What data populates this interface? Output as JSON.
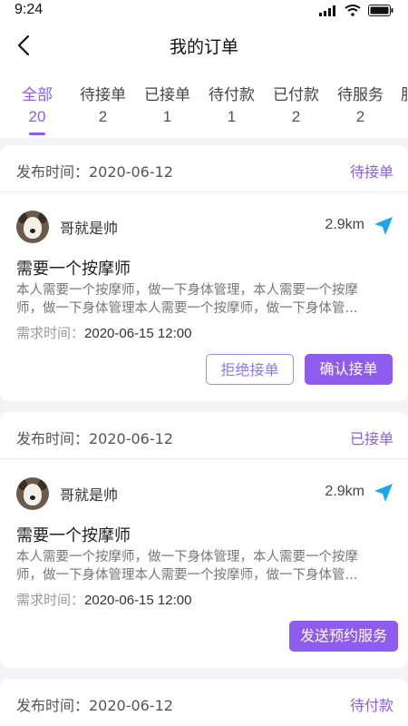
{
  "status_bar": {
    "time": "9:24"
  },
  "nav": {
    "title": "我的订单"
  },
  "tabs": [
    {
      "label": "全部",
      "count": "20"
    },
    {
      "label": "待接单",
      "count": "2"
    },
    {
      "label": "已接单",
      "count": "1"
    },
    {
      "label": "待付款",
      "count": "1"
    },
    {
      "label": "已付款",
      "count": "2"
    },
    {
      "label": "待服务",
      "count": "2"
    },
    {
      "label": "服",
      "count": ""
    }
  ],
  "orders": [
    {
      "publish_label": "发布时间：2020-06-12",
      "status": "待接单",
      "user_name": "哥就是帅",
      "distance": "2.9km",
      "title": "需要一个按摩师",
      "desc_line1": "本人需要一个按摩师，做一下身体管理，本人需要一个按摩",
      "desc_line2": "师，做一下身体管理本人需要一个按摩师，做一下身体管...",
      "demand_key": "需求时间：",
      "demand_value": "2020-06-15 12:00",
      "buttons": [
        "拒绝接单",
        "确认接单"
      ]
    },
    {
      "publish_label": "发布时间：2020-06-12",
      "status": "已接单",
      "user_name": "哥就是帅",
      "distance": "2.9km",
      "title": "需要一个按摩师",
      "desc_line1": "本人需要一个按摩师，做一下身体管理，本人需要一个按摩",
      "desc_line2": "师，做一下身体管理本人需要一个按摩师，做一下身体管...",
      "demand_key": "需求时间：",
      "demand_value": "2020-06-15 12:00",
      "buttons": [
        "发送预约服务"
      ]
    },
    {
      "publish_label": "发布时间：2020-06-12",
      "status": "待付款"
    }
  ],
  "colors": {
    "accent": "#8a5cf0",
    "nav_arrow": "#1aa7f0"
  }
}
